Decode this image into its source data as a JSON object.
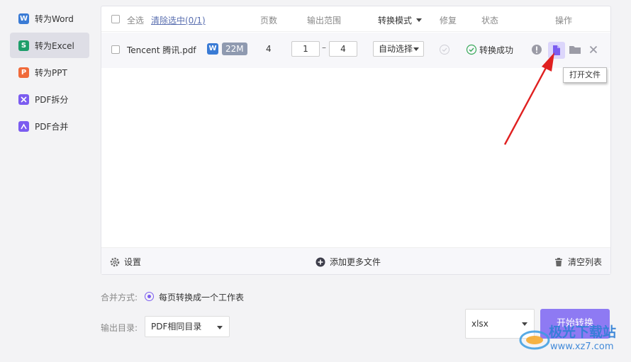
{
  "sidebar": {
    "items": [
      {
        "label": "转为Word",
        "icon_color": "#3a7bd5",
        "glyph": "W",
        "active": false
      },
      {
        "label": "转为Excel",
        "icon_color": "#1e9e6a",
        "glyph": "S",
        "active": true
      },
      {
        "label": "转为PPT",
        "icon_color": "#f06a3a",
        "glyph": "P",
        "active": false
      },
      {
        "label": "PDF拆分",
        "icon_color": "#7b5cf0",
        "glyph": "✂",
        "active": false
      },
      {
        "label": "PDF合并",
        "icon_color": "#7b5cf0",
        "glyph": "⌃",
        "active": false
      }
    ]
  },
  "table": {
    "select_all": "全选",
    "clear_selected": "清除选中(0/1)",
    "col_pages": "页数",
    "col_range": "输出范围",
    "col_mode": "转换模式",
    "col_repair": "修复",
    "col_status": "状态",
    "col_actions": "操作",
    "rows": [
      {
        "filename": "Tencent 腾讯.pdf",
        "type_badge": "W",
        "size": "22M",
        "pages": "4",
        "range_from": "1",
        "range_sep": "–",
        "range_to": "4",
        "mode": "自动选择",
        "status": "转换成功"
      }
    ]
  },
  "tooltip": "打开文件",
  "footer": {
    "settings": "设置",
    "add_more": "添加更多文件",
    "clear_list": "清空列表"
  },
  "options": {
    "merge_label": "合并方式:",
    "merge_value": "每页转换成一个工作表",
    "output_label": "输出目录:",
    "output_value": "PDF相同目录",
    "format_value": "xlsx",
    "start_button": "开始转换"
  },
  "watermark": {
    "line1": "极光下载站",
    "line2": "www.xz7.com"
  },
  "colors": {
    "accent": "#8e7af3",
    "success": "#3aaa5a",
    "arrow": "#e02020"
  }
}
